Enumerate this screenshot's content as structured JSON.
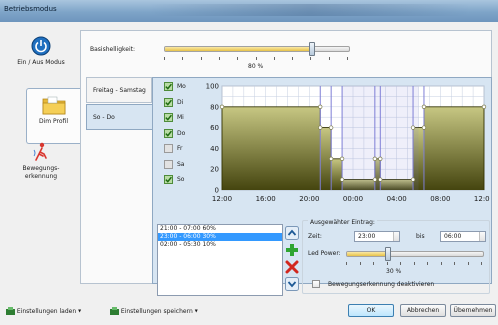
{
  "window": {
    "title": "Betriebsmodus"
  },
  "nav": [
    {
      "label": "Ein / Aus Modus",
      "icon": "power-icon",
      "active": false
    },
    {
      "label": "Dim Profil",
      "icon": "folder-icon",
      "active": true
    },
    {
      "label": "Bewegungs- erkennung",
      "icon": "motion-icon",
      "active": false
    }
  ],
  "base": {
    "label": "Basishelligkeit:",
    "value_text": "80 %",
    "value": 0.8
  },
  "tabs": [
    {
      "label": "Freitag - Samstag",
      "active": false
    },
    {
      "label": "So - Do",
      "active": true
    }
  ],
  "days": [
    {
      "label": "Mo",
      "checked": true
    },
    {
      "label": "Di",
      "checked": true
    },
    {
      "label": "Mi",
      "checked": true
    },
    {
      "label": "Do",
      "checked": true
    },
    {
      "label": "Fr",
      "checked": false
    },
    {
      "label": "Sa",
      "checked": false
    },
    {
      "label": "So",
      "checked": true
    }
  ],
  "chart_data": {
    "type": "area",
    "x_tick_labels": [
      "12:00",
      "16:00",
      "20:00",
      "00:00",
      "04:00",
      "08:00",
      "12:00"
    ],
    "y_tick_labels": [
      "0",
      "20",
      "40",
      "60",
      "80",
      "100"
    ],
    "ylim": [
      0,
      100
    ],
    "xlim_hours": [
      0,
      24
    ],
    "grid": true,
    "steps": [
      {
        "from": 0,
        "to": 9,
        "value": 80
      },
      {
        "from": 9,
        "to": 10,
        "value": 60
      },
      {
        "from": 10,
        "to": 11,
        "value": 30
      },
      {
        "from": 11,
        "to": 14,
        "value": 10
      },
      {
        "from": 14,
        "to": 14.5,
        "value": 30
      },
      {
        "from": 14.5,
        "to": 17.5,
        "value": 10
      },
      {
        "from": 17.5,
        "to": 18.5,
        "value": 60
      },
      {
        "from": 18.5,
        "to": 24,
        "value": 80
      }
    ],
    "colors": {
      "fill_top": "#c7c783",
      "fill_bottom": "#45450f",
      "line": "#333300",
      "selected_band": "#7f7fd6"
    }
  },
  "entries": [
    {
      "text": "21:00 - 07:00  60%",
      "selected": false
    },
    {
      "text": "23:00 - 06:00  30%",
      "selected": true
    },
    {
      "text": "02:00 - 05:30  10%",
      "selected": false
    }
  ],
  "editor": {
    "group_label": "Ausgewähter Eintrag:",
    "from_label": "Zeit:",
    "from_value": "23:00",
    "to_label": "bis",
    "to_value": "06:00",
    "led_label": "Led Power:",
    "led_value_text": "30 %",
    "led_value": 0.3,
    "motion_label": "Bewegungserkennung deaktivieren",
    "motion_checked": false
  },
  "footer": {
    "load_label": "Einstellungen laden",
    "save_label": "Einstellungen speichern",
    "ok_label": "OK",
    "cancel_label": "Abbrechen",
    "apply_label": "Übernehmen"
  }
}
